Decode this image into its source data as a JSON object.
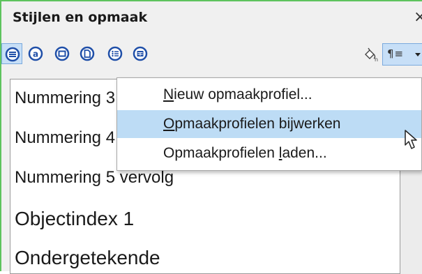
{
  "panel": {
    "title": "Stijlen en opmaak",
    "close_glyph": "×"
  },
  "toolbar": {
    "buttons": [
      {
        "name": "paragraph-styles-icon",
        "active": true
      },
      {
        "name": "character-styles-icon",
        "active": false
      },
      {
        "name": "frame-styles-icon",
        "active": false
      },
      {
        "name": "page-styles-icon",
        "active": false
      },
      {
        "name": "list-styles-icon",
        "active": false
      },
      {
        "name": "table-styles-icon",
        "active": false
      }
    ],
    "fill_format_icon": "fill-format-mode-icon",
    "styles_actions_glyph": "¶≡"
  },
  "style_list": {
    "items": [
      "Nummering 3 vervolg",
      "Nummering 4 vervolg",
      "Nummering 5 vervolg",
      "Objectindex 1",
      "Ondergetekende"
    ]
  },
  "context_menu": {
    "items": [
      {
        "label": "Nieuw opmaakprofiel...",
        "mnemonic": "N",
        "highlighted": false
      },
      {
        "label": "Opmaakprofielen bijwerken",
        "mnemonic": "O",
        "highlighted": true
      },
      {
        "label": "Opmaakprofielen laden...",
        "mnemonic": "l",
        "highlighted": false
      }
    ]
  },
  "colors": {
    "accent_border": "#5ec35e",
    "highlight": "#bddcf5",
    "active_button": "#c7dff7",
    "icon_blue": "#1f4fa8"
  }
}
